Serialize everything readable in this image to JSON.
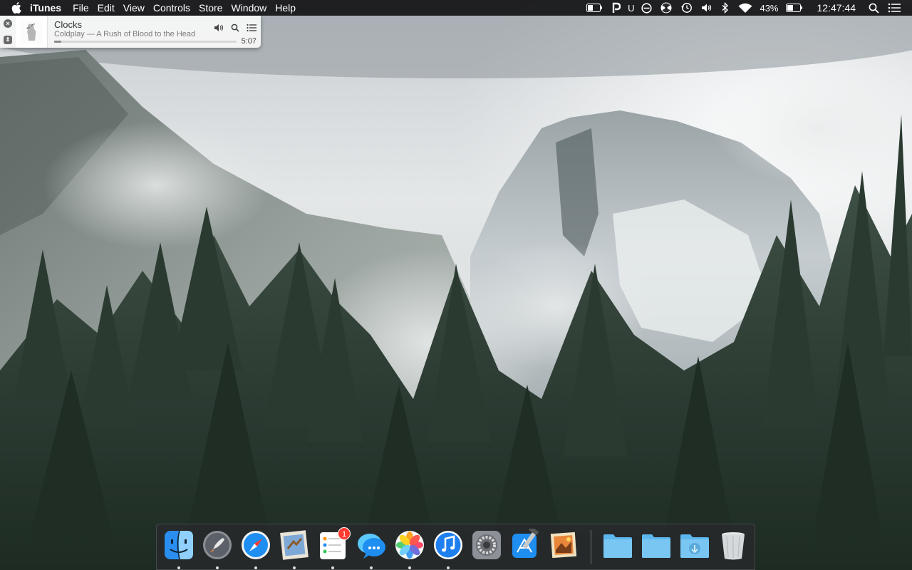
{
  "menubar": {
    "app_name": "iTunes",
    "menus": [
      "File",
      "Edit",
      "View",
      "Controls",
      "Store",
      "Window",
      "Help"
    ],
    "status": {
      "u_text": "U",
      "battery_percent": "43%",
      "clock": "12:47:44"
    }
  },
  "mini_player": {
    "title": "Clocks",
    "subtitle": "Coldplay — A Rush of Blood to the Head",
    "time": "5:07",
    "progress": 0.04
  },
  "dock": {
    "badge_reminders": "1"
  },
  "colors": {
    "menubar_bg": "#161618",
    "dock_bg": "#28282c",
    "badge": "#ff3b30"
  }
}
